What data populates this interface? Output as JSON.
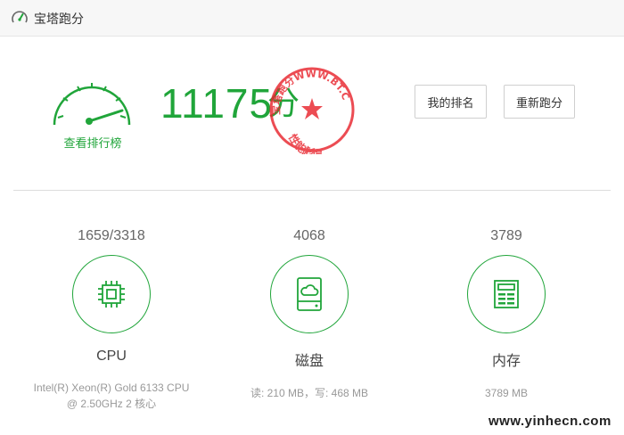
{
  "window": {
    "title": "宝塔跑分",
    "icon": "speedometer-icon"
  },
  "score": {
    "value": "11175",
    "unit": "分",
    "rank_link": "查看排行榜",
    "stamp": {
      "top_text": "宝塔跑分WWW.BT.CN",
      "bottom_text": "性能彪悍",
      "color": "#e8252e"
    }
  },
  "buttons": {
    "my_rank": "我的排名",
    "rerun": "重新跑分"
  },
  "metrics": [
    {
      "value": "1659/3318",
      "label": "CPU",
      "detail": "Intel(R) Xeon(R) Gold 6133 CPU @ 2.50GHz 2 核心",
      "icon": "cpu-chip-icon"
    },
    {
      "value": "4068",
      "label": "磁盘",
      "detail": "读: 210 MB，写: 468 MB",
      "icon": "disk-cloud-icon"
    },
    {
      "value": "3789",
      "label": "内存",
      "detail": "3789 MB",
      "icon": "memory-doc-icon"
    }
  ],
  "watermark": "www.yinhecn.com",
  "colors": {
    "accent": "#20a53a",
    "stamp_red": "#e8252e"
  }
}
